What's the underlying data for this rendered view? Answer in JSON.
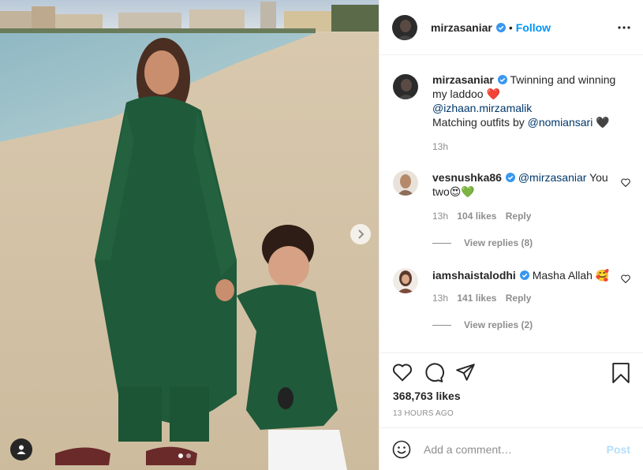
{
  "post": {
    "username": "mirzasaniar",
    "follow_label": "Follow",
    "separator": "•",
    "colors": {
      "accent": "#0095f6",
      "mention": "#00376b",
      "muted": "#8e8e8e",
      "dress": "#1f5a3a"
    }
  },
  "caption": {
    "username": "mirzasaniar",
    "text1": "Twinning and winning my laddoo",
    "emoji1": "❤️",
    "mention1": "@izhaan.mirzamalik",
    "text2": "Matching outfits by",
    "mention2": "@nomiansari",
    "emoji2": "🖤",
    "time": "13h"
  },
  "comments": [
    {
      "username": "vesnushka86",
      "mention": "@mirzasaniar",
      "text": "You two😍💚",
      "time": "13h",
      "likes": "104 likes",
      "reply_label": "Reply",
      "view_replies": "View replies (8)"
    },
    {
      "username": "iamshaistalodhi",
      "text": "Masha Allah 🥰",
      "time": "13h",
      "likes": "141 likes",
      "reply_label": "Reply",
      "view_replies": "View replies (2)"
    }
  ],
  "engagement": {
    "likes": "368,763 likes",
    "timestamp": "13 HOURS AGO"
  },
  "composer": {
    "placeholder": "Add a comment…",
    "post_label": "Post"
  },
  "carousel": {
    "count": 2,
    "active": 1
  }
}
